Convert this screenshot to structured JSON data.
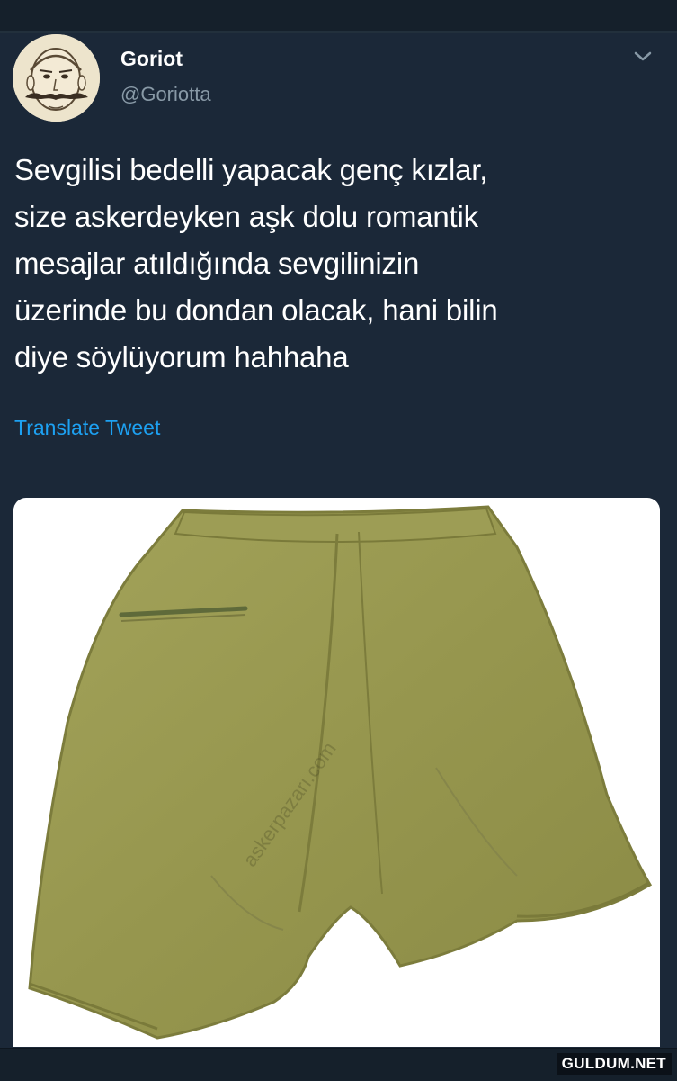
{
  "tweet": {
    "author_name": "Goriot",
    "author_handle": "@Goriotta",
    "text": "Sevgilisi bedelli yapacak genç kızlar,\nsize askerdeyken aşk dolu romantik\nmesajlar atıldığında sevgilinizin\nüzerinde bu dondan olacak, hani bilin\ndiye söylüyorum hahhaha",
    "translate_label": "Translate Tweet"
  },
  "media": {
    "watermark": "askerpazarı.com"
  },
  "site_badge": "GULDUM.NET",
  "icons": {
    "menu": "chevron-down-icon"
  },
  "colors": {
    "background": "#15202b",
    "card": "#1b2838",
    "link": "#1da1f2",
    "handle": "#8899a6",
    "shorts": "#9b9a4f"
  }
}
